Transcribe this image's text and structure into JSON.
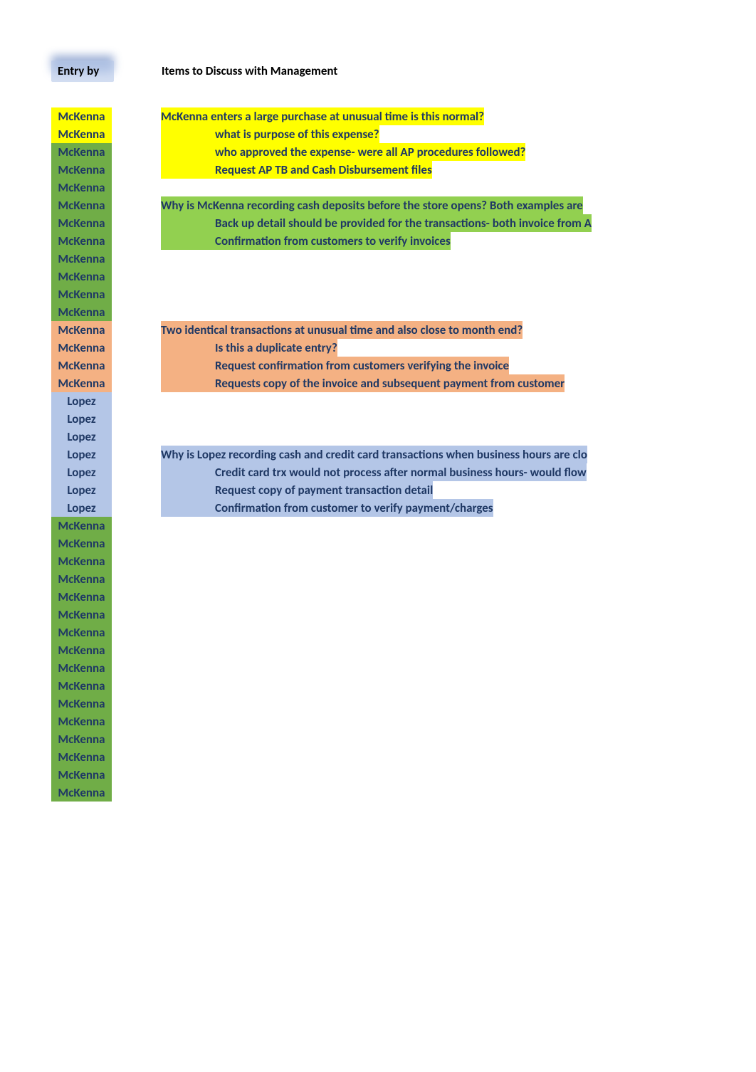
{
  "headers": {
    "col_a": "Entry by",
    "col_b": "Items to Discuss with Management"
  },
  "rows": [
    {
      "name": "McKenna",
      "name_hl": "hl-yellow",
      "item": "McKenna enters a large purchase at unusual time is this normal?",
      "item_hl": "hl-yellow",
      "indent": 0
    },
    {
      "name": "McKenna",
      "name_hl": "hl-yellow",
      "item": "what is purpose of this expense?",
      "item_hl": "hl-yellow",
      "indent": 1
    },
    {
      "name": "McKenna",
      "name_hl": "hl-green",
      "item": "who approved the expense- were all AP procedures followed?",
      "item_hl": "hl-yellow",
      "indent": 1
    },
    {
      "name": "McKenna",
      "name_hl": "hl-green",
      "item": "Request AP TB and Cash Disbursement files",
      "item_hl": "hl-yellow",
      "indent": 1
    },
    {
      "name": "McKenna",
      "name_hl": "hl-green",
      "item": "",
      "item_hl": "",
      "indent": 0
    },
    {
      "name": "McKenna",
      "name_hl": "hl-green",
      "item": "Why is McKenna recording cash deposits before the store opens? Both examples are",
      "item_hl": "hl-green-l",
      "indent": 0
    },
    {
      "name": "McKenna",
      "name_hl": "hl-green",
      "item": "Back up detail should be provided for the transactions- both invoice from A",
      "item_hl": "hl-green-l",
      "indent": 1
    },
    {
      "name": "McKenna",
      "name_hl": "hl-green",
      "item": "Confirmation from customers to verify invoices",
      "item_hl": "hl-green-l",
      "indent": 1
    },
    {
      "name": "McKenna",
      "name_hl": "hl-green",
      "item": "",
      "item_hl": "",
      "indent": 0
    },
    {
      "name": "McKenna",
      "name_hl": "hl-green",
      "item": "",
      "item_hl": "",
      "indent": 0
    },
    {
      "name": "McKenna",
      "name_hl": "hl-green",
      "item": "",
      "item_hl": "",
      "indent": 0
    },
    {
      "name": "McKenna",
      "name_hl": "hl-green",
      "item": "",
      "item_hl": "",
      "indent": 0
    },
    {
      "name": "McKenna",
      "name_hl": "hl-orange",
      "item": "Two identical transactions at unusual time and also close to month end?",
      "item_hl": "hl-orange",
      "indent": 0
    },
    {
      "name": "McKenna",
      "name_hl": "hl-orange",
      "item": "Is this a duplicate entry?",
      "item_hl": "hl-orange",
      "indent": 1
    },
    {
      "name": "McKenna",
      "name_hl": "hl-orange",
      "item": "Request confirmation from customers verifying the invoice",
      "item_hl": "hl-orange",
      "indent": 1
    },
    {
      "name": "McKenna",
      "name_hl": "hl-orange",
      "item": "Requests copy of the invoice and subsequent payment from customer",
      "item_hl": "hl-orange",
      "indent": 1
    },
    {
      "name": "Lopez",
      "name_hl": "hl-blue",
      "item": "",
      "item_hl": "",
      "indent": 0
    },
    {
      "name": "Lopez",
      "name_hl": "hl-blue",
      "item": "",
      "item_hl": "",
      "indent": 0
    },
    {
      "name": "Lopez",
      "name_hl": "hl-blue",
      "item": "",
      "item_hl": "",
      "indent": 0
    },
    {
      "name": "Lopez",
      "name_hl": "hl-blue",
      "item": "Why is Lopez recording cash and credit card transactions when business hours are clo",
      "item_hl": "hl-blue",
      "indent": 0
    },
    {
      "name": "Lopez",
      "name_hl": "hl-blue",
      "item": "Credit card trx would not process after normal business hours- would flow",
      "item_hl": "hl-blue",
      "indent": 1
    },
    {
      "name": "Lopez",
      "name_hl": "hl-blue",
      "item": "Request copy of payment transaction detail",
      "item_hl": "hl-blue",
      "indent": 1
    },
    {
      "name": "Lopez",
      "name_hl": "hl-blue",
      "item": "Confirmation from customer to verify payment/charges",
      "item_hl": "hl-blue",
      "indent": 1
    },
    {
      "name": "McKenna",
      "name_hl": "hl-green",
      "item": "",
      "item_hl": "",
      "indent": 0
    },
    {
      "name": "McKenna",
      "name_hl": "hl-green",
      "item": "",
      "item_hl": "",
      "indent": 0
    },
    {
      "name": "McKenna",
      "name_hl": "hl-green",
      "item": "",
      "item_hl": "",
      "indent": 0
    },
    {
      "name": "McKenna",
      "name_hl": "hl-green",
      "item": "",
      "item_hl": "",
      "indent": 0
    },
    {
      "name": "McKenna",
      "name_hl": "hl-green",
      "item": "",
      "item_hl": "",
      "indent": 0
    },
    {
      "name": "McKenna",
      "name_hl": "hl-green",
      "item": "",
      "item_hl": "",
      "indent": 0
    },
    {
      "name": "McKenna",
      "name_hl": "hl-green",
      "item": "",
      "item_hl": "",
      "indent": 0
    },
    {
      "name": "McKenna",
      "name_hl": "hl-green",
      "item": "",
      "item_hl": "",
      "indent": 0
    },
    {
      "name": "McKenna",
      "name_hl": "hl-green",
      "item": "",
      "item_hl": "",
      "indent": 0
    },
    {
      "name": "McKenna",
      "name_hl": "hl-green",
      "item": "",
      "item_hl": "",
      "indent": 0
    },
    {
      "name": "McKenna",
      "name_hl": "hl-green",
      "item": "",
      "item_hl": "",
      "indent": 0
    },
    {
      "name": "McKenna",
      "name_hl": "hl-green",
      "item": "",
      "item_hl": "",
      "indent": 0
    },
    {
      "name": "McKenna",
      "name_hl": "hl-green",
      "item": "",
      "item_hl": "",
      "indent": 0
    },
    {
      "name": "McKenna",
      "name_hl": "hl-green",
      "item": "",
      "item_hl": "",
      "indent": 0
    },
    {
      "name": "McKenna",
      "name_hl": "hl-green",
      "item": "",
      "item_hl": "",
      "indent": 0
    },
    {
      "name": "McKenna",
      "name_hl": "hl-green",
      "item": "",
      "item_hl": "",
      "indent": 0
    }
  ]
}
